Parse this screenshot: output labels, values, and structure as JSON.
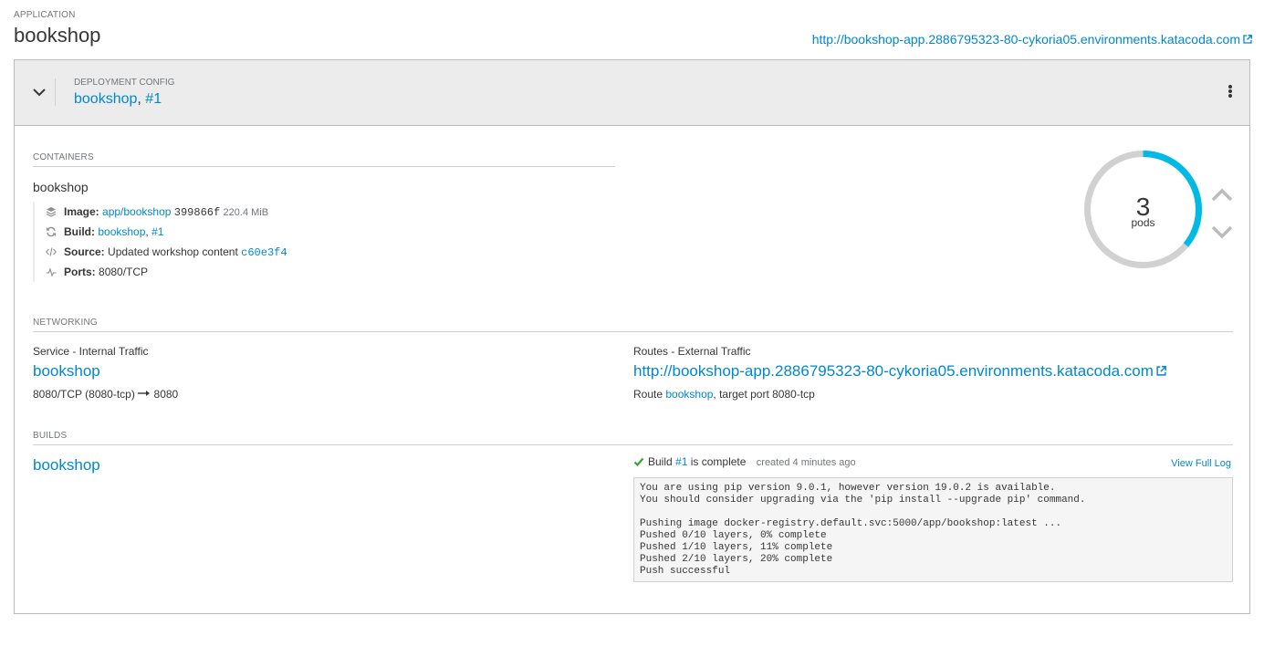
{
  "application": {
    "label": "APPLICATION",
    "name": "bookshop",
    "url": "http://bookshop-app.2886795323-80-cykoria05.environments.katacoda.com"
  },
  "deployment": {
    "label": "DEPLOYMENT CONFIG",
    "name": "bookshop",
    "separator": ",",
    "revision": "#1"
  },
  "containers": {
    "title": "CONTAINERS",
    "name": "bookshop",
    "image": {
      "label": "Image:",
      "link": "app/bookshop",
      "hash": "399866f",
      "size": "220.4 MiB"
    },
    "build": {
      "label": "Build:",
      "name": "bookshop",
      "separator": ",",
      "number": "#1"
    },
    "source": {
      "label": "Source:",
      "text": "Updated workshop content",
      "commit": "c60e3f4"
    },
    "ports": {
      "label": "Ports:",
      "value": "8080/TCP"
    }
  },
  "pods": {
    "count": "3",
    "label": "pods",
    "ready_fraction": 0.36
  },
  "networking": {
    "title": "NETWORKING",
    "service": {
      "label": "Service - Internal Traffic",
      "name": "bookshop",
      "port_from": "8080/TCP (8080-tcp)",
      "port_to": "8080"
    },
    "routes": {
      "label": "Routes - External Traffic",
      "url": "http://bookshop-app.2886795323-80-cykoria05.environments.katacoda.com",
      "prefix": "Route",
      "route_name": "bookshop",
      "suffix": ", target port 8080-tcp"
    }
  },
  "builds": {
    "title": "BUILDS",
    "name": "bookshop",
    "status_prefix": "Build",
    "build_number": "#1",
    "status_suffix": "is complete",
    "created": "created 4 minutes ago",
    "view_log": "View Full Log",
    "log": "You are using pip version 9.0.1, however version 19.0.2 is available.\nYou should consider upgrading via the 'pip install --upgrade pip' command.\n\nPushing image docker-registry.default.svc:5000/app/bookshop:latest ...\nPushed 0/10 layers, 0% complete\nPushed 1/10 layers, 11% complete\nPushed 2/10 layers, 20% complete\nPush successful"
  },
  "colors": {
    "link": "#0088ce",
    "donut_active": "#00b9e4",
    "donut_track": "#d1d1d1",
    "success": "#3f9c35"
  },
  "icons": [
    "external-link-icon",
    "chevron-down-icon",
    "kebab-menu-icon",
    "image-layers-icon",
    "build-refresh-icon",
    "code-icon",
    "ports-pulse-icon",
    "chevron-up-icon",
    "arrow-right-icon",
    "check-icon"
  ]
}
